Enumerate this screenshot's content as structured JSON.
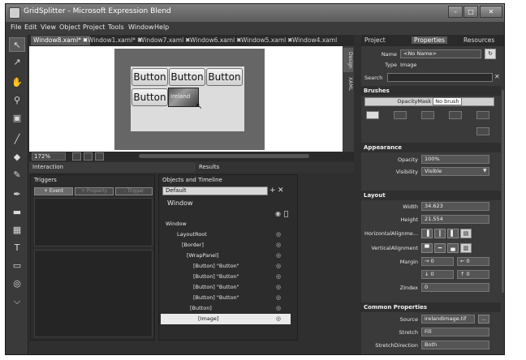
{
  "window": {
    "title": "GridSplitter - Microsoft Expression Blend",
    "controls": {
      "minimize": "–",
      "maximize": "□",
      "close": "✕"
    }
  },
  "menu": [
    "File",
    "Edit",
    "View",
    "Object",
    "Project",
    "Tools",
    "Window",
    "Help"
  ],
  "toolbox": {
    "tools": [
      "selection-icon",
      "direct-selection-icon",
      "pan-icon",
      "zoom-icon",
      "camera-orbit-icon",
      "eyedropper-icon",
      "paint-bucket-icon",
      "brush-transform-icon",
      "pen-icon",
      "rectangle-icon",
      "layout-panel-icon",
      "text-icon",
      "controls-icon",
      "asset-tool-icon",
      "more-icon"
    ]
  },
  "doc_tabs": [
    {
      "label": "Window8.xaml*",
      "active": true
    },
    {
      "label": "Window1.xaml*",
      "active": false
    },
    {
      "label": "Window7.xaml",
      "active": false
    },
    {
      "label": "Window6.xaml",
      "active": false
    },
    {
      "label": "Window5.xaml",
      "active": false
    },
    {
      "label": "Window4.xaml",
      "active": false
    }
  ],
  "tab_close": "✖",
  "canvas": {
    "buttons": [
      "Button",
      "Button",
      "Button",
      "Button"
    ],
    "selected_image_label": "Ireland"
  },
  "view_tabs": [
    "Design",
    "XAML"
  ],
  "statusbar": {
    "zoom": "172%"
  },
  "interaction": {
    "header": "Interaction",
    "results_tab": "Results",
    "triggers_label": "Triggers",
    "add_event": "+ Event",
    "add_property": "+ Property",
    "remove_trigger": "- Trigger",
    "objects_label": "Objects and Timeline",
    "storyboard_value": "Default",
    "root_label": "Window",
    "tree": [
      {
        "indent": 0,
        "label": "Window",
        "selected": false
      },
      {
        "indent": 1,
        "label": "LayoutRoot",
        "selected": false
      },
      {
        "indent": 2,
        "label": "[Border]",
        "selected": false
      },
      {
        "indent": 3,
        "label": "[WrapPanel]",
        "selected": false
      },
      {
        "indent": 4,
        "label": "[Button] \"Button\"",
        "selected": false
      },
      {
        "indent": 4,
        "label": "[Button] \"Button\"",
        "selected": false
      },
      {
        "indent": 4,
        "label": "[Button] \"Button\"",
        "selected": false
      },
      {
        "indent": 4,
        "label": "[Button] \"Button\"",
        "selected": false
      },
      {
        "indent": 4,
        "label": "[Button]",
        "selected": false
      },
      {
        "indent": 5,
        "label": "[Image]",
        "selected": true
      }
    ]
  },
  "right_tabs": [
    {
      "label": "Project",
      "active": false
    },
    {
      "label": "Properties",
      "active": true
    },
    {
      "label": "Resources",
      "active": false
    }
  ],
  "properties": {
    "name_label": "Name",
    "name_value": "<No Name>",
    "type_label": "Type",
    "type_value": "Image",
    "search_label": "Search",
    "search_value": "",
    "brushes": {
      "header": "Brushes",
      "opacity_mask_label": "OpacityMask",
      "opacity_mask_value": "No brush"
    },
    "appearance": {
      "header": "Appearance",
      "opacity_label": "Opacity",
      "opacity_value": "100%",
      "visibility_label": "Visibility",
      "visibility_value": "Visible"
    },
    "layout": {
      "header": "Layout",
      "width_label": "Width",
      "width_value": "34.623",
      "height_label": "Height",
      "height_value": "21.554",
      "halign_label": "HorizontalAlignme...",
      "valign_label": "VerticalAlignment",
      "margin_label": "Margin",
      "margin_values": [
        "0",
        "0",
        "0",
        "0"
      ],
      "zindex_label": "ZIndex",
      "zindex_value": "0"
    },
    "common": {
      "header": "Common Properties",
      "source_label": "Source",
      "source_value": "irelandimage.tif",
      "stretch_label": "Stretch",
      "stretch_value": "Fill",
      "stretchdir_label": "StretchDirection",
      "stretchdir_value": "Both"
    }
  }
}
